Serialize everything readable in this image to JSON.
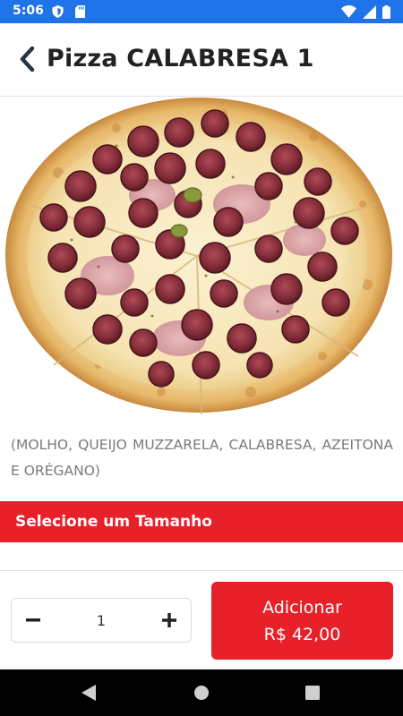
{
  "status_bar": {
    "time": "5:06",
    "left_icons": [
      "shield-icon",
      "sd-card-icon"
    ],
    "right_icons": [
      "wifi-icon",
      "signal-icon",
      "battery-icon"
    ]
  },
  "header": {
    "title": "Pizza CALABRESA 1",
    "back_icon": "chevron-left-icon"
  },
  "product": {
    "image": "pizza-calabresa-photo",
    "description": "(MOLHO, QUEIJO MUZZARELA, CALABRESA, AZEITONA E ORÉGANO)"
  },
  "size_section": {
    "label": "Selecione um Tamanho"
  },
  "footer": {
    "quantity": "1",
    "minus_icon": "minus-icon",
    "plus_icon": "plus-icon",
    "add_button_label": "Adicionar",
    "add_button_price": "R$ 42,00"
  },
  "nav_bar": {
    "icons": [
      "back-triangle-icon",
      "home-circle-icon",
      "recents-square-icon"
    ]
  },
  "colors": {
    "status_bar": "#1e73e8",
    "accent_red": "#e8202a",
    "text_gray": "#7a7a7a",
    "title": "#222222"
  }
}
